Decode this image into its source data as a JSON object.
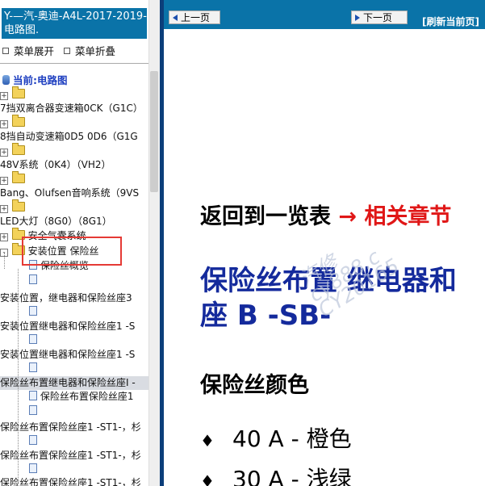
{
  "sidebar": {
    "title": "Y-—汽-奥迪-A4L-2017-2019- 电路图.",
    "expand_label": "菜单展开",
    "collapse_label": "菜单折叠",
    "current_label": "当前:电路图",
    "tree": [
      {
        "id": "r1",
        "label": "7挡双离合器变速箱0CK（G1C）",
        "type": "folder",
        "expander": "+",
        "highlighted": false
      },
      {
        "id": "r2",
        "label": "8挡自动变速箱0D5 0D6（G1G",
        "type": "folder",
        "expander": "+",
        "highlighted": false
      },
      {
        "id": "r3",
        "label": "48V系统（0K4）（VH2）",
        "type": "folder",
        "expander": "+",
        "highlighted": false
      },
      {
        "id": "r4",
        "label": "Bang、Olufsen音响系统（9VS",
        "type": "folder",
        "expander": "+",
        "highlighted": false
      },
      {
        "id": "r5",
        "label": "LED大灯（8G0）（8G1）",
        "type": "folder",
        "expander": "+",
        "highlighted": false
      },
      {
        "id": "r6",
        "label": "安全气囊系统",
        "type": "folder",
        "expander": "+",
        "highlighted": false
      },
      {
        "id": "r7",
        "label": "安装位置 保险丝",
        "type": "folder",
        "expander": "-",
        "highlighted": false
      },
      {
        "id": "r8",
        "label": "保险丝概览",
        "type": "doc",
        "highlighted": false
      },
      {
        "id": "r9",
        "label": "安装位置，继电器和保险丝座3",
        "type": "doc",
        "highlighted": false
      },
      {
        "id": "r10",
        "label": "安装位置继电器和保险丝座1 -S",
        "type": "doc",
        "highlighted": false
      },
      {
        "id": "r11",
        "label": "安装位置继电器和保险丝座1 -S",
        "type": "doc",
        "highlighted": false
      },
      {
        "id": "r12",
        "label": "保险丝布置继电器和保险丝座I -",
        "type": "doc",
        "highlighted": true
      },
      {
        "id": "r13",
        "label": "保险丝布置保险丝座1",
        "type": "doc",
        "highlighted": false
      },
      {
        "id": "r14",
        "label": "保险丝布置保险丝座1 -ST1-，杉",
        "type": "doc",
        "highlighted": false
      },
      {
        "id": "r15",
        "label": "保险丝布置保险丝座1 -ST1-，杉",
        "type": "doc",
        "highlighted": false
      },
      {
        "id": "r16",
        "label": "保险丝布置保险丝座1 -ST1-，杉",
        "type": "doc",
        "highlighted": false
      }
    ]
  },
  "toolbar": {
    "prev_label": "上一页",
    "next_label": "下一页",
    "refresh_label": "[刷新当前页]"
  },
  "content": {
    "back_text": "返回到一览表",
    "arrow": "→",
    "related_text": "相关章节",
    "heading_line1": "保险丝布置 继电器和",
    "heading_line2": "座 B -SB-",
    "subheading": "保险丝颜色",
    "bullet_glyph": "♦",
    "items": [
      {
        "value": "40 A - 橙色"
      },
      {
        "value": "30 A - 浅绿"
      }
    ],
    "watermark_line1": "汽修",
    "watermark_line2": "cy888.c",
    "watermark_line3": "CY20165"
  },
  "colors": {
    "header_blue": "#0a73a8",
    "heading_blue": "#142a9c",
    "accent_red": "#e01717",
    "annotation_red": "#e53a35"
  }
}
